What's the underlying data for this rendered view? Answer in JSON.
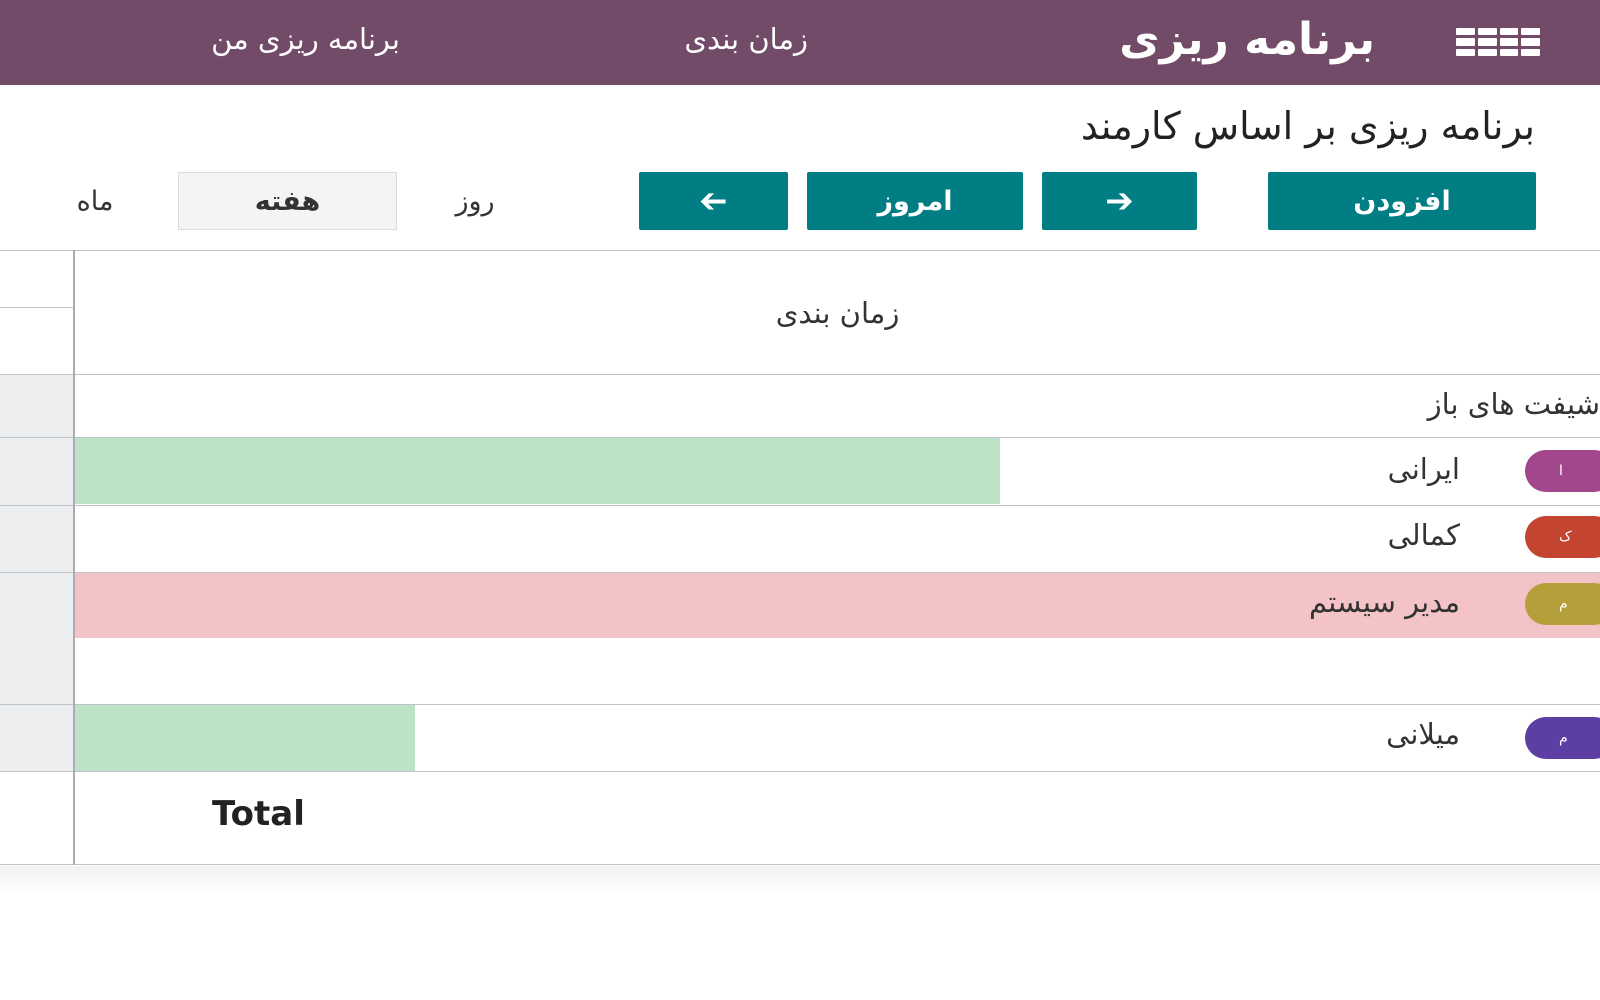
{
  "topbar": {
    "icon": "apps-grid-icon",
    "app_title": "برنامه ریزی",
    "menu": [
      "زمان بندی",
      "برنامه ریزی من"
    ]
  },
  "control_panel": {
    "title": "برنامه ریزی بر اساس کارمند",
    "add_label": "افزودن",
    "next_icon": "arrow-right-icon",
    "today_label": "امروز",
    "prev_icon": "arrow-left-icon",
    "scales": {
      "day": "روز",
      "week": "هفته",
      "month": "ماه"
    },
    "active_scale": "week"
  },
  "gantt": {
    "header_title": "زمان بندی",
    "group_open_shifts": "شیفت های باز",
    "rows": [
      {
        "name": "ایرانی",
        "avatar": "ا",
        "avatar_color": "#a2478b",
        "bar_color": "#bde3c6"
      },
      {
        "name": "کمالی",
        "avatar": "ک",
        "avatar_color": "#c4452f"
      },
      {
        "name": "مدیر سیستم",
        "avatar": "م",
        "avatar_color": "#b59f3b",
        "row_color": "#f4c3c8"
      },
      {
        "name": "میلانی",
        "avatar": "م",
        "avatar_color": "#5d3fa3",
        "bar_color": "#bde3c6"
      }
    ],
    "total_label": "Total"
  },
  "colors": {
    "topbar": "#714b67",
    "primary_button": "#017e84",
    "grid_line": "#bfc3c7"
  }
}
